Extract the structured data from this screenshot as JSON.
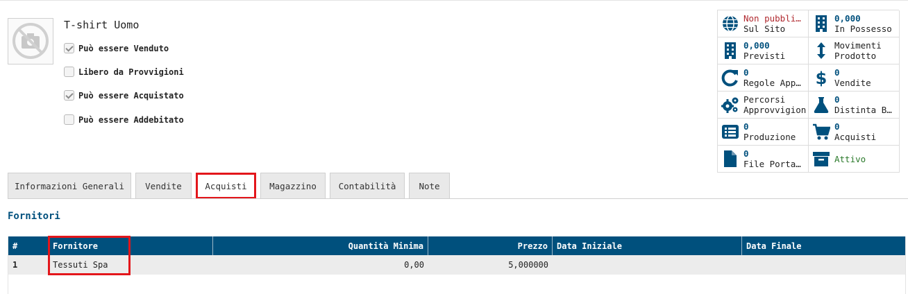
{
  "product": {
    "name": "T-shirt Uomo",
    "image_icon": "camera-disabled-icon"
  },
  "options": [
    {
      "label": "Può essere Venduto",
      "checked": true
    },
    {
      "label": "Libero da Provvigioni",
      "checked": false
    },
    {
      "label": "Può essere Acquistato",
      "checked": true
    },
    {
      "label": "Può essere Addebitato",
      "checked": false
    }
  ],
  "smart_buttons": [
    {
      "icon": "globe-icon",
      "value": "Non pubbli…",
      "label": "Sul Sito"
    },
    {
      "icon": "building-icon",
      "value": "0,000",
      "label": "In Possesso"
    },
    {
      "icon": "building-icon",
      "value": "0,000",
      "label": "Previsti"
    },
    {
      "icon": "arrows-vertical-icon",
      "value": "Movimenti",
      "label": "Prodotto"
    },
    {
      "icon": "refresh-icon",
      "value": "0",
      "label": "Regole App…"
    },
    {
      "icon": "dollar-icon",
      "value": "0",
      "label": "Vendite"
    },
    {
      "icon": "gears-icon",
      "value": "Percorsi",
      "label": "Approvvigion"
    },
    {
      "icon": "flask-icon",
      "value": "0",
      "label": "Distinta B…"
    },
    {
      "icon": "list-icon",
      "value": "0",
      "label": "Produzione"
    },
    {
      "icon": "cart-icon",
      "value": "0",
      "label": "Acquisti"
    },
    {
      "icon": "file-icon",
      "value": "0",
      "label": "File Porta…"
    },
    {
      "icon": "archive-icon",
      "value": "",
      "label": "Attivo"
    }
  ],
  "tabs": [
    {
      "label": "Informazioni Generali"
    },
    {
      "label": "Vendite"
    },
    {
      "label": "Acquisti"
    },
    {
      "label": "Magazzino"
    },
    {
      "label": "Contabilità"
    },
    {
      "label": "Note"
    }
  ],
  "section": {
    "title": "Fornitori"
  },
  "table": {
    "headers": [
      "#",
      "Fornitore",
      "Quantità Minima",
      "Prezzo",
      "Data Iniziale",
      "Data Finale"
    ],
    "rows": [
      {
        "num": "1",
        "supplier": "Tessuti Spa",
        "min_qty": "0,00",
        "price": "5,000000",
        "date_start": "",
        "date_end": ""
      }
    ]
  },
  "colors": {
    "primary": "#00507d",
    "highlight": "#e3161b",
    "unpublished": "#b0292f",
    "active": "#2b7a2b"
  }
}
